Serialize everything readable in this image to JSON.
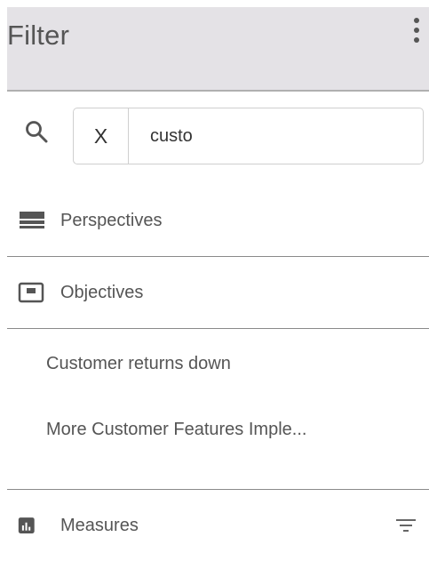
{
  "header": {
    "title": "Filter",
    "menu_icon": "kebab-menu-icon"
  },
  "search": {
    "icon": "search-icon",
    "clear_label": "X",
    "value": "custo"
  },
  "sections": {
    "perspectives": {
      "label": "Perspectives",
      "icon": "perspectives-icon"
    },
    "objectives": {
      "label": "Objectives",
      "icon": "objectives-icon",
      "items": [
        "Customer returns down",
        "More Customer Features Imple..."
      ]
    },
    "measures": {
      "label": "Measures",
      "icon": "measures-chart-icon",
      "action_icon": "filter-icon"
    }
  },
  "colors": {
    "header_bg": "#e4e2e6",
    "divider": "#8a8a8a",
    "text": "#555555"
  }
}
